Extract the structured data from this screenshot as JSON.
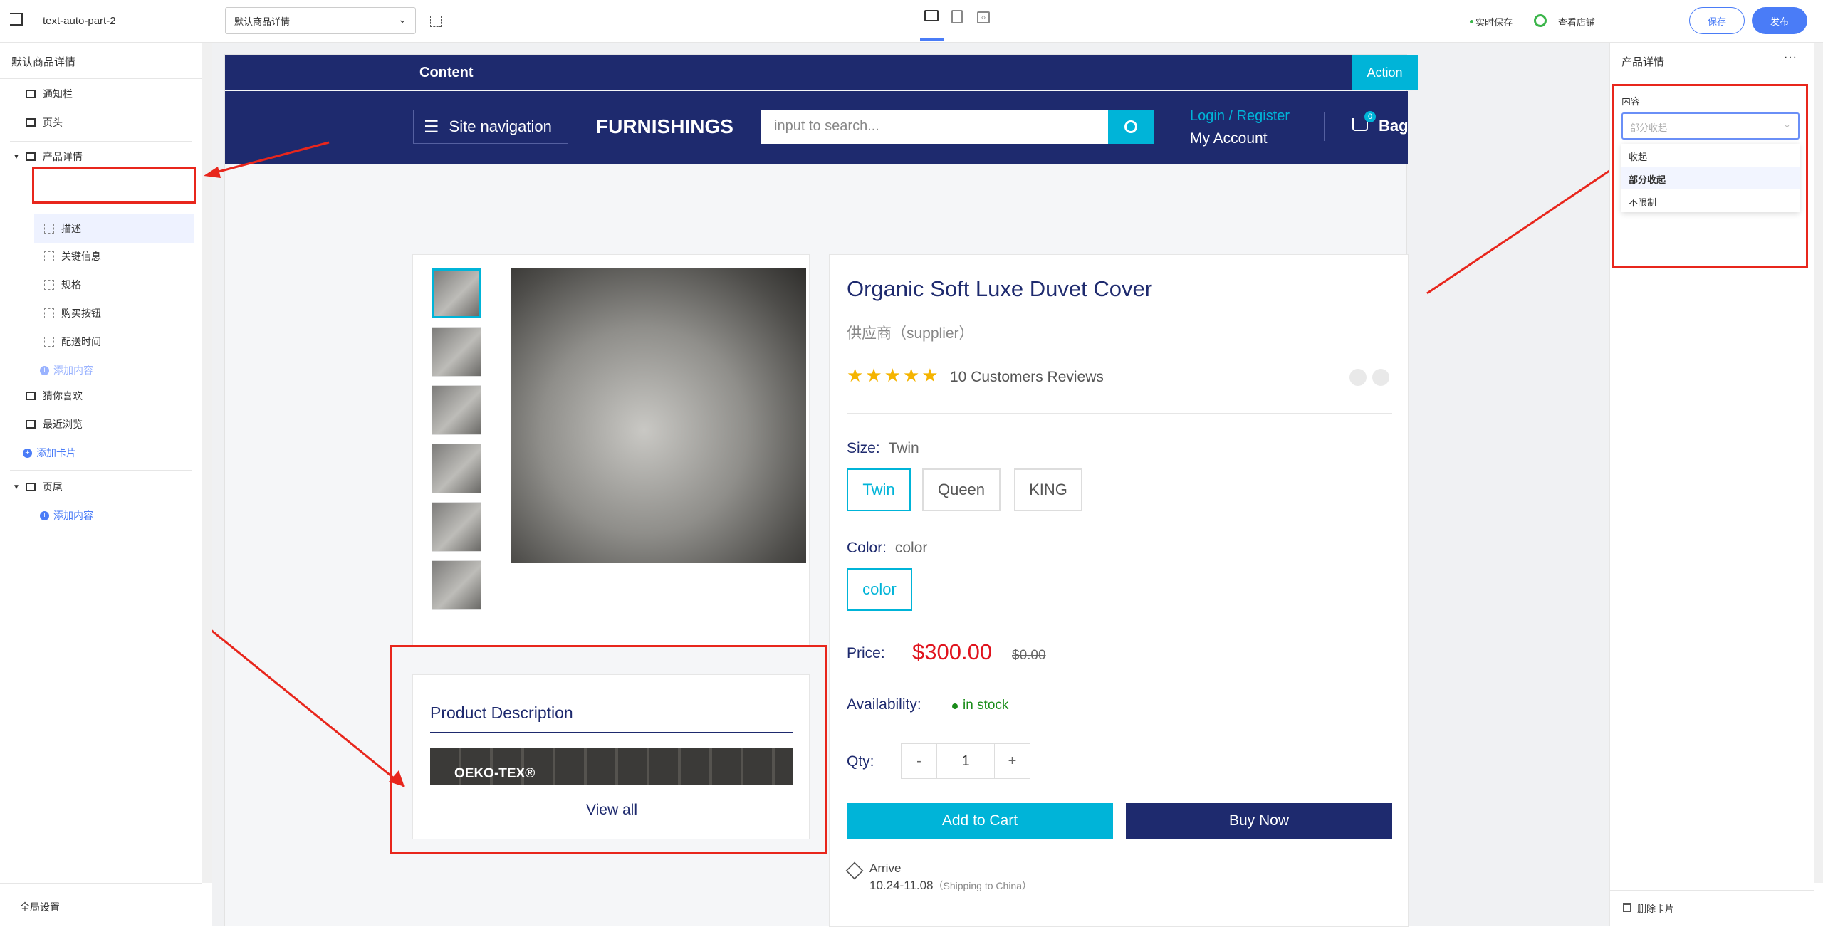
{
  "topbar": {
    "project_name": "text-auto-part-2",
    "page_select": "默认商品详情",
    "autosave": "实时保存",
    "view_store": "查看店铺",
    "save": "保存",
    "publish": "发布"
  },
  "left_panel": {
    "title": "默认商品详情",
    "items": [
      {
        "label": "通知栏"
      },
      {
        "label": "页头"
      },
      {
        "label": "产品详情"
      },
      {
        "label": "描述"
      },
      {
        "label": "关键信息"
      },
      {
        "label": "规格"
      },
      {
        "label": "购买按钮"
      },
      {
        "label": "配送时间"
      },
      {
        "label": "添加内容"
      },
      {
        "label": "猜你喜欢"
      },
      {
        "label": "最近浏览"
      },
      {
        "label": "添加卡片"
      },
      {
        "label": "页尾"
      },
      {
        "label": "添加内容"
      }
    ],
    "global_settings": "全局设置"
  },
  "store": {
    "topbar_content": "Content",
    "topbar_action": "Action",
    "site_nav": "Site navigation",
    "logo": "FURNISHINGS",
    "search_placeholder": "input to search...",
    "login": "Login / Register",
    "account": "My Account",
    "bag_count": "0",
    "bag": "Bag",
    "colors": {
      "header": "#1e2a6e",
      "accent": "#00b4d8",
      "price": "#e0141e"
    }
  },
  "product": {
    "title": "Organic Soft Luxe Duvet Cover",
    "supplier": "供应商（supplier）",
    "rating": 5,
    "reviews": "10 Customers Reviews",
    "size_label": "Size:",
    "size_value": "Twin",
    "sizes": [
      "Twin",
      "Queen",
      "KING"
    ],
    "color_label": "Color:",
    "color_value": "color",
    "colors": [
      "color"
    ],
    "price_label": "Price:",
    "price": "$300.00",
    "compare_price": "$0.00",
    "availability_label": "Availability:",
    "availability": "in stock",
    "qty_label": "Qty:",
    "qty_minus": "-",
    "qty_value": "1",
    "qty_plus": "+",
    "add_to_cart": "Add to Cart",
    "buy_now": "Buy Now",
    "arrive_label": "Arrive",
    "arrive_dates": "10.24-11.08",
    "arrive_note": "（Shipping to China）",
    "description_title": "Product Description",
    "oeko": "OEKO-TEX®",
    "view_all": "View all"
  },
  "right_panel": {
    "title": "产品详情",
    "section_label": "内容",
    "select_value": "部分收起",
    "options": [
      "收起",
      "部分收起",
      "不限制"
    ],
    "delete_card": "删除卡片"
  }
}
